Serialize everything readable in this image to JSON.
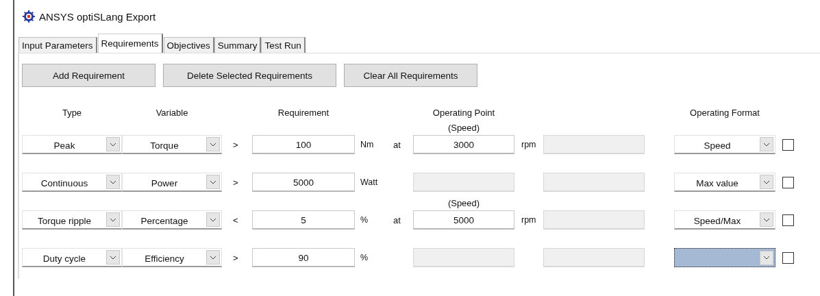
{
  "window": {
    "title": "ANSYS optiSLang Export"
  },
  "tabs": [
    {
      "label": "Input Parameters",
      "selected": false
    },
    {
      "label": "Requirements",
      "selected": true
    },
    {
      "label": "Objectives",
      "selected": false
    },
    {
      "label": "Summary",
      "selected": false
    },
    {
      "label": "Test Run",
      "selected": false
    }
  ],
  "buttons": [
    "Add Requirement",
    "Delete Selected Requirements",
    "Clear All Requirements"
  ],
  "columns": {
    "type": "Type",
    "variable": "Variable",
    "requirement": "Requirement",
    "operating_point": "Operating Point",
    "operating_format": "Operating Format"
  },
  "rows": [
    {
      "type": "Peak",
      "variable": "Torque",
      "comparator": ">",
      "requirement": "100",
      "unit": "Nm",
      "at": "at",
      "operating_point": {
        "caption": "(Speed)",
        "value": "3000",
        "unit": "rpm",
        "disabled": false
      },
      "extra_field": {
        "disabled": true
      },
      "format": {
        "value": "Speed",
        "focused": false
      },
      "checked": false
    },
    {
      "type": "Continuous",
      "variable": "Power",
      "comparator": ">",
      "requirement": "5000",
      "unit": "Watt",
      "operating_point": {
        "disabled": true
      },
      "extra_field": {
        "disabled": true
      },
      "format": {
        "value": "Max value",
        "focused": false
      },
      "checked": false
    },
    {
      "type": "Torque ripple",
      "variable": "Percentage",
      "comparator": "<",
      "requirement": "5",
      "unit": "%",
      "at": "at",
      "operating_point": {
        "caption": "(Speed)",
        "value": "5000",
        "unit": "rpm",
        "disabled": false
      },
      "extra_field": {
        "disabled": true
      },
      "format": {
        "value": "Speed/Max",
        "focused": false
      },
      "checked": false
    },
    {
      "type": "Duty cycle",
      "variable": "Efficiency",
      "comparator": ">",
      "requirement": "90",
      "unit": "%",
      "operating_point": {
        "disabled": true
      },
      "extra_field": {
        "disabled": true
      },
      "format": {
        "focused": true
      },
      "checked": false
    }
  ]
}
